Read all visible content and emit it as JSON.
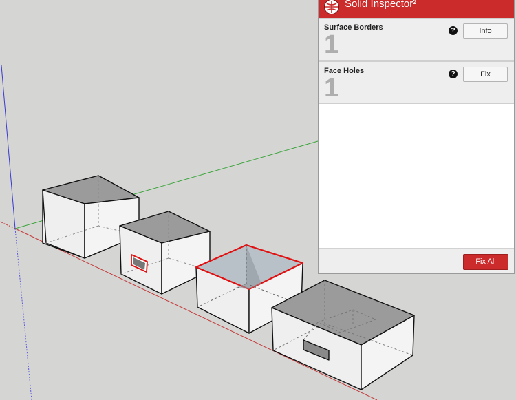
{
  "panel": {
    "title": "Solid Inspector²",
    "issues": [
      {
        "name": "Surface Borders",
        "count": "1",
        "help": "?",
        "button": "Info"
      },
      {
        "name": "Face Holes",
        "count": "1",
        "help": "?",
        "button": "Fix"
      }
    ],
    "fix_all": "Fix All"
  },
  "colors": {
    "accent": "#cc2b2b",
    "background": "#d5d5d3",
    "x_axis": "#c43a3a",
    "y_axis": "#3aa53a",
    "z_axis": "#3a3ad0",
    "highlight_edge": "#e01010"
  },
  "icons": {
    "logo": "solid-inspector-logo-icon",
    "help": "help-icon"
  }
}
